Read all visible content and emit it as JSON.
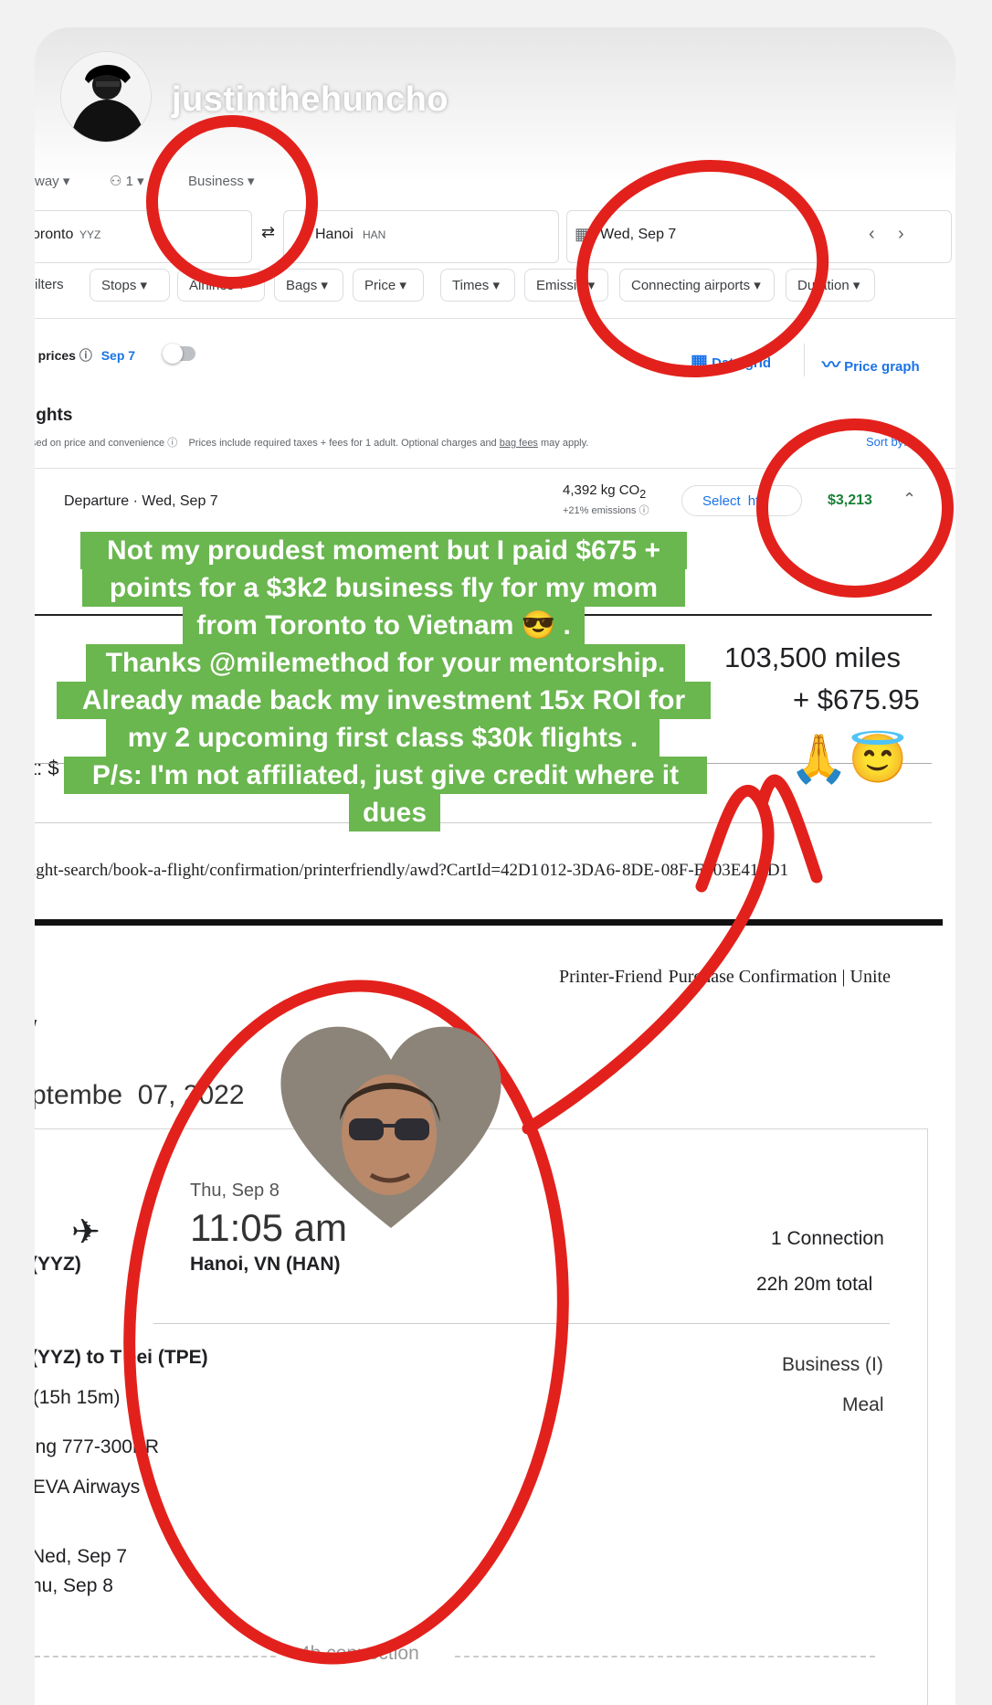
{
  "story": {
    "username": "justinthehuncho"
  },
  "flights": {
    "trip_type": "way",
    "passengers": "1",
    "cabin": "Business",
    "origin": "oronto",
    "origin_code": "YYZ",
    "destination": "Hanoi",
    "destination_code": "HAN",
    "date": "Wed, Sep 7",
    "filters": [
      "ilters",
      "Stops",
      "Airlines",
      "Bags",
      "Price",
      "Times",
      "Emissio",
      "Connecting airports",
      "Duration"
    ],
    "track_prices_label": "k prices",
    "track_prices_date": "Sep 7",
    "date_grid": "Date grid",
    "price_graph": "Price graph",
    "section_title": "ights",
    "ranking_note": "sed on price and convenience",
    "price_note_a": "Prices include required taxes + fees for 1 adult. Optional charges and ",
    "price_note_link": "bag fees",
    "price_note_b": " may apply.",
    "sort_by": "Sort by:",
    "departure_label": "Departure",
    "departure_date": "Wed, Sep 7",
    "emissions_value": "4,392 kg CO",
    "emissions_sub": "2",
    "emissions_pct": "+21% emissions",
    "select_button": "Select",
    "select_tail": "ht",
    "price": "$3,213"
  },
  "caption": {
    "lines": [
      "Not my proudest moment but I paid $675 +",
      "points for a $3k2 business fly for my mom",
      "from Toronto to Vietnam 😎 .",
      "Thanks @milemethod  for your mentorship.",
      "Already made back my investment 15x ROI for",
      "my 2 upcoming first class $30k flights .",
      "P/s: I'm not affiliated, just give credit where it",
      "dues"
    ]
  },
  "miles": {
    "line1": "103,500 miles",
    "line2": "+ $675.95",
    "partial_label": "t: $",
    "emoji": "🙏😇"
  },
  "confirmation": {
    "url": "ight-search/book-a-flight/confirmation/printerfriendly/awd?CartId=42D1 012-3DA6- 8DE- 08F-E703E418D1",
    "header_right": "Printer-Friend  Purchase Confirmation | Unite",
    "slash": "/",
    "date": "ptembe  07, 2022",
    "arrive_day": "Thu, Sep 8",
    "arrive_time": "11:05 am",
    "origin_code": "(YYZ)",
    "arrive_city": "Hanoi, VN (HAN)",
    "connections": "1 Connection",
    "total_time": "22h 20m total",
    "segment_route": "(YYZ) to T  pei (TPE)",
    "segment_duration": " (15h 15m)",
    "aircraft": "ing 777-300ER",
    "airline": " EVA Airways",
    "cabin": "Business (I)",
    "meal": "Meal",
    "dep_date": "Ned, Sep 7",
    "arr_date": "hu, Sep 8",
    "connection_note": "4h connection"
  },
  "colors": {
    "annotation_red": "#e3211c",
    "caption_green": "#6ab64f",
    "google_blue": "#1a73e8",
    "price_green": "#188038"
  }
}
